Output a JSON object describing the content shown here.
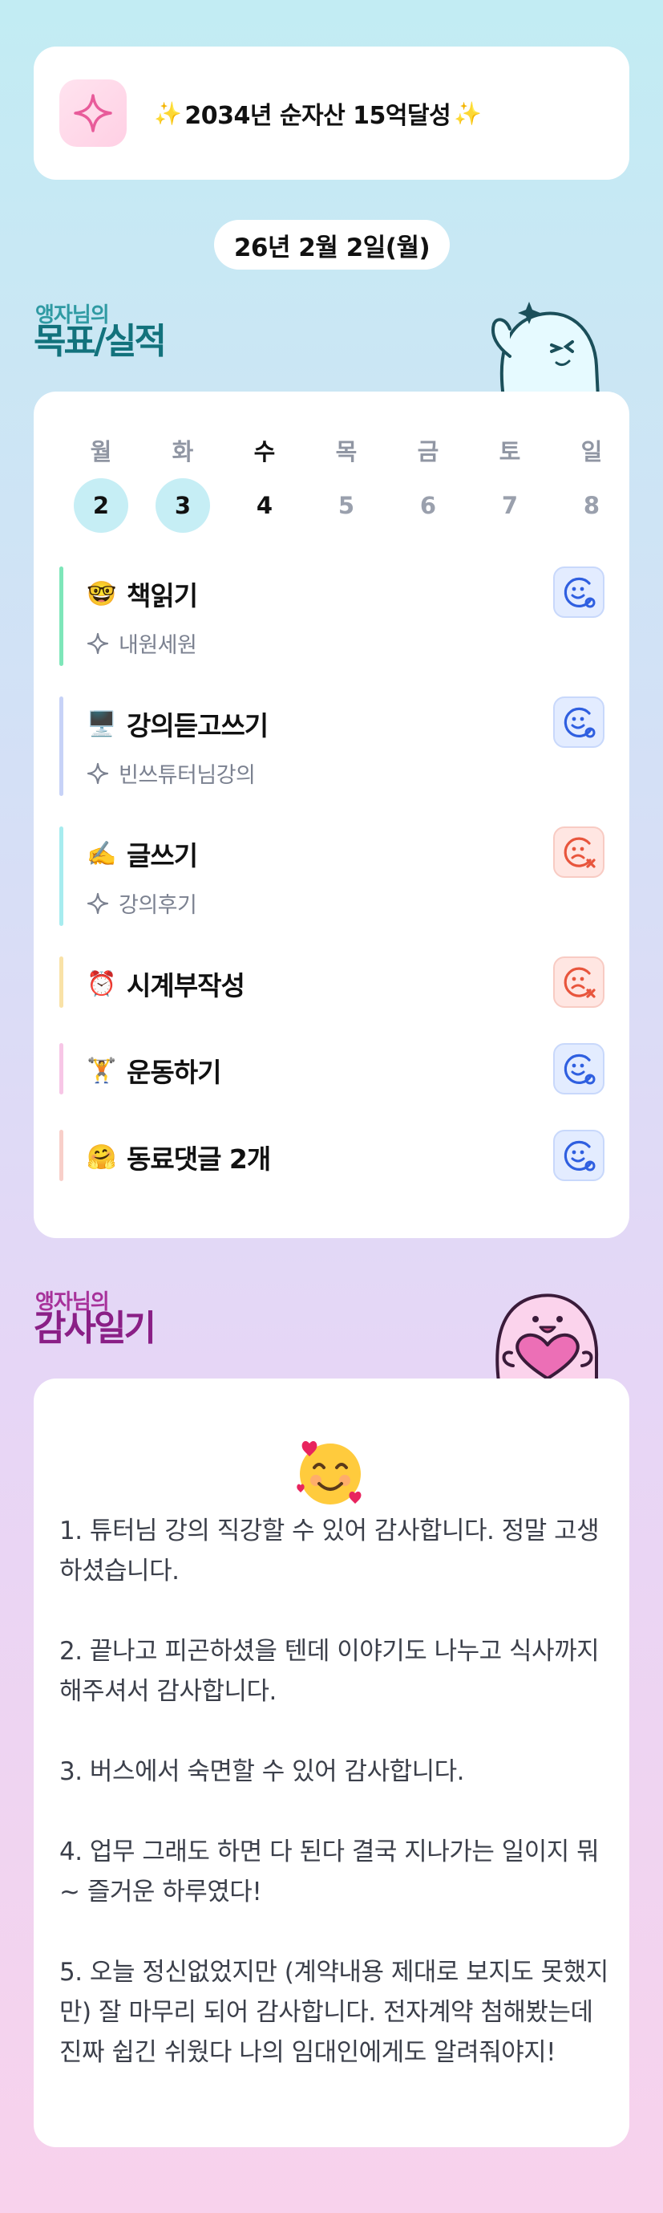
{
  "goal": {
    "sparkle_left": "✨",
    "text": "2034년 순자산 15억달성",
    "sparkle_right": "✨",
    "icon": "sparkle-star-icon"
  },
  "date_label": "26년 2월 2일(월)",
  "goals_section": {
    "subtitle": "앵자님의",
    "title": "목표/실적"
  },
  "week": {
    "days": [
      "월",
      "화",
      "수",
      "목",
      "금",
      "토",
      "일"
    ],
    "dates": [
      "2",
      "3",
      "4",
      "5",
      "6",
      "7",
      "8"
    ],
    "done_indexes": [
      0,
      1
    ],
    "today_index": 2
  },
  "tasks": [
    {
      "emoji": "🤓",
      "title": "책읽기",
      "sub": "내원세원",
      "status": "good",
      "bar_color": "#7ee6b9"
    },
    {
      "emoji": "🖥️",
      "title": "강의듣고쓰기",
      "sub": "빈쓰튜터님강의",
      "status": "good",
      "bar_color": "#c7d2f7"
    },
    {
      "emoji": "✍️",
      "title": "글쓰기",
      "sub": "강의후기",
      "status": "bad",
      "bar_color": "#a7ecef"
    },
    {
      "emoji": "⏰",
      "title": "시계부작성",
      "sub": "",
      "status": "bad",
      "bar_color": "#f9e2a7"
    },
    {
      "emoji": "🏋️",
      "title": "운동하기",
      "sub": "",
      "status": "good",
      "bar_color": "#f7c6e6"
    },
    {
      "emoji": "🤗",
      "title": "동료댓글 2개",
      "sub": "",
      "status": "good",
      "bar_color": "#f8cfc9"
    }
  ],
  "gratitude_section": {
    "subtitle": "앵자님의",
    "title": "감사일기",
    "emoji": "🥰",
    "entries": [
      "1. 튜터님 강의 직강할 수 있어 감사합니다. 정말 고생하셨습니다.",
      "2. 끝나고 피곤하셨을 텐데 이야기도 나누고 식사까지 해주셔서 감사합니다.",
      "3. 버스에서 숙면할 수 있어 감사합니다.",
      "4. 업무 그래도 하면 다 된다 결국 지나가는 일이지 뭐~ 즐거운 하루였다!",
      "5. 오늘 정신없었지만 (계약내용 제대로 보지도 못했지만) 잘 마무리 되어 감사합니다. 전자계약 첨해봤는데 진짜 쉽긴 쉬웠다 나의 임대인에게도 알려줘야지!"
    ]
  },
  "colors": {
    "good_face": "#2f5fe0",
    "bad_face": "#e8553c",
    "done_circle": "#c6eef5"
  }
}
